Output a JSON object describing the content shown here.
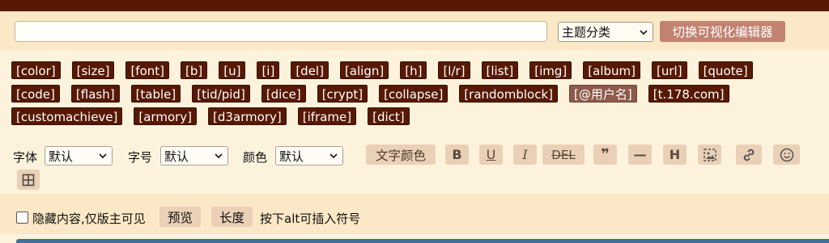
{
  "title_input": {
    "value": "",
    "placeholder": ""
  },
  "topic_select": {
    "selected": "主题分类",
    "icon": "chevron-down-icon"
  },
  "switch_editor_label": "切换可视化编辑器",
  "tag_rows": [
    [
      "[color]",
      "[size]",
      "[font]",
      "[b]",
      "[u]",
      "[i]",
      "[del]",
      "[align]",
      "[h]",
      "[l/r]",
      "[list]",
      "[img]",
      "[album]",
      "[url]",
      "[quote]"
    ],
    [
      "[code]",
      "[flash]",
      "[table]",
      "[tid/pid]",
      "[dice]",
      "[crypt]",
      "[collapse]",
      "[randomblock]",
      "[@用户名]",
      "[t.178.com]"
    ],
    [
      "[customachieve]",
      "[armory]",
      "[d3armory]",
      "[iframe]",
      "[dict]"
    ]
  ],
  "format": {
    "font_label": "字体",
    "font_value": "默认",
    "size_label": "字号",
    "size_value": "默认",
    "color_label": "颜色",
    "color_value": "默认",
    "text_color_label": "文字颜色",
    "bold_label": "B",
    "underline_label": "U",
    "italic_label": "I",
    "strike_label": "DEL",
    "quote_label": "❞",
    "hr_label": "—",
    "heading_label": "H",
    "icons": {
      "image": "image-icon",
      "link": "link-icon",
      "emoji": "smiley-icon",
      "table": "table-icon"
    }
  },
  "bottom": {
    "hidden_content_label": "隐藏内容,仅版主可见",
    "preview_label": "预览",
    "length_label": "长度",
    "hint": "按下alt可插入符号"
  },
  "colors": {
    "topbar": "#591804",
    "tag_bg": "#571904",
    "tag_soft_bg": "#8e5a4b",
    "switch_btn": "#c28270",
    "toolbar_btn": "#ead0b6",
    "page_bg": "#fdf3dd",
    "row_bg": "#fbe8c6"
  }
}
